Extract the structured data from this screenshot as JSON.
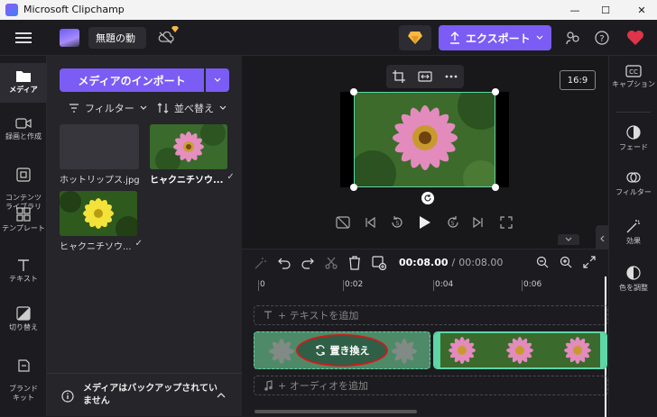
{
  "window": {
    "title": "Microsoft Clipchamp",
    "minimize": "—",
    "maximize": "☐",
    "close": "✕"
  },
  "header": {
    "project_name": "無題の動",
    "export_label": "エクスポート"
  },
  "left_nav": [
    {
      "label": "メディア",
      "icon": "folder-icon"
    },
    {
      "label": "録画と作成",
      "icon": "camera-icon"
    },
    {
      "label": "コンテンツ\nライブラリ",
      "icon": "library-icon"
    },
    {
      "label": "テンプレート",
      "icon": "template-icon"
    },
    {
      "label": "テキスト",
      "icon": "text-icon"
    },
    {
      "label": "切り替え",
      "icon": "transition-icon"
    },
    {
      "label": "ブランド\nキット",
      "icon": "brand-icon"
    }
  ],
  "media": {
    "import_label": "メディアのインポート",
    "filter_label": "フィルター",
    "sort_label": "並べ替え",
    "items": [
      {
        "name": "ホットリップス.jpg",
        "type": "empty"
      },
      {
        "name": "ヒャクニチソウ...",
        "type": "pink",
        "check": "✓"
      },
      {
        "name": "ヒャクニチソウ...",
        "type": "yellow",
        "check": "✓"
      }
    ],
    "backup_notice": "メディアはバックアップされていません"
  },
  "preview": {
    "aspect_ratio": "16:9"
  },
  "right_panel": [
    {
      "label": "キャプション",
      "icon": "captions-icon"
    },
    {
      "label": "フェード",
      "icon": "fade-icon"
    },
    {
      "label": "フィルター",
      "icon": "filter-icon"
    },
    {
      "label": "効果",
      "icon": "effects-icon"
    },
    {
      "label": "色を調整",
      "icon": "color-icon"
    }
  ],
  "timeline": {
    "current_time": "00:08.00",
    "separator": "/",
    "total_time": "00:08.00",
    "ruler": [
      "0",
      "0:02",
      "0:04",
      "0:06"
    ],
    "add_text": "+ テキストを追加",
    "add_audio": "+ オーディオを追加",
    "replace_label": "置き換え"
  },
  "colors": {
    "accent": "#7b5cf5",
    "clip_border": "#5ed6a6",
    "highlight": "#d11a1a"
  }
}
